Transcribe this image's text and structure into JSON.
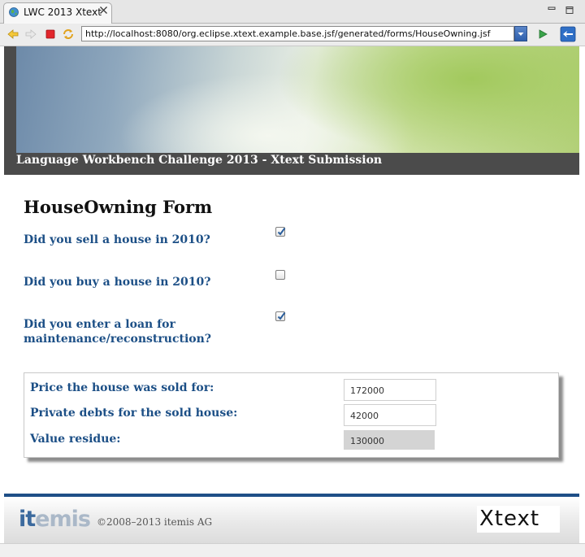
{
  "browser": {
    "tab_title": "LWC 2013 Xtext",
    "url": "http://localhost:8080/org.eclipse.xtext.example.base.jsf/generated/forms/HouseOwning.jsf"
  },
  "banner": {
    "caption": "Language Workbench Challenge 2013 - Xtext Submission"
  },
  "form": {
    "title": "HouseOwning Form",
    "questions": [
      {
        "label": "Did you sell a house in 2010?",
        "checked": true
      },
      {
        "label": "Did you buy a house in 2010?",
        "checked": false
      },
      {
        "label": "Did you enter a loan for maintenance/reconstruction?",
        "checked": true
      }
    ],
    "computed": [
      {
        "label": "Price the house was sold for:",
        "value": "172000",
        "readonly": false
      },
      {
        "label": "Private debts for the sold house:",
        "value": "42000",
        "readonly": false
      },
      {
        "label": "Value residue:",
        "value": "130000",
        "readonly": true
      }
    ]
  },
  "footer": {
    "logo_it": "it",
    "logo_emis": "emis",
    "copyright": "©2008–2013 itemis AG",
    "xtext_logo": "Xtext"
  },
  "colors": {
    "label_blue": "#1c4f86",
    "footer_rule": "#1e4f87"
  },
  "icons": [
    "globe-icon",
    "close-icon",
    "minimize-icon",
    "maximize-icon",
    "back-icon",
    "forward-icon",
    "stop-icon",
    "refresh-icon",
    "dropdown-icon",
    "go-icon",
    "app-icon",
    "checkmark-icon"
  ]
}
